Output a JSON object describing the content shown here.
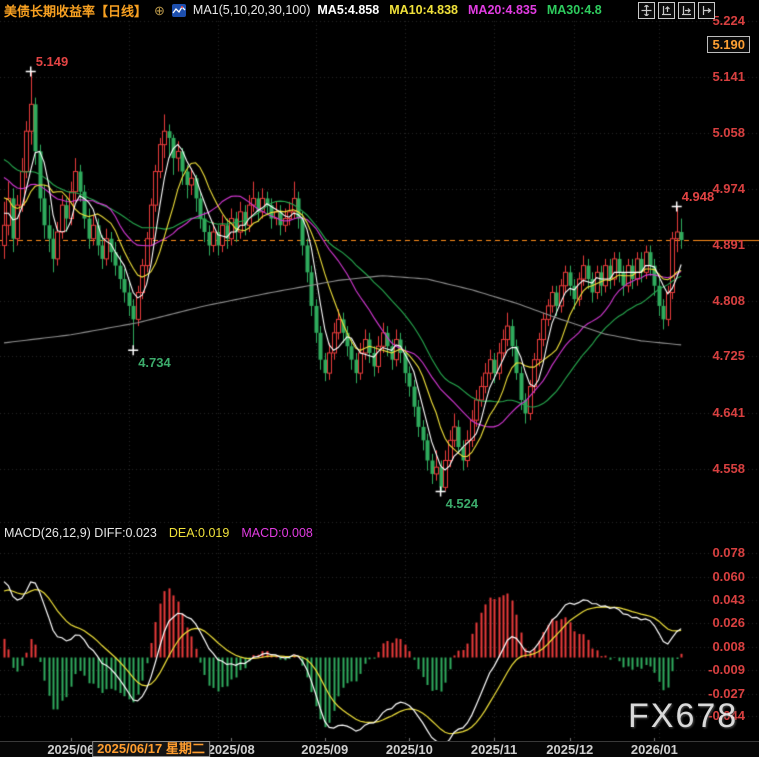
{
  "header": {
    "title": "美债长期收益率【日线】",
    "link_glyph": "⊕",
    "indicator_label": "MA1(5,10,20,30,100)",
    "ma_values": [
      {
        "label": "MA5:4.858",
        "color": "#ffffff"
      },
      {
        "label": "MA10:4.838",
        "color": "#f0e13a"
      },
      {
        "label": "MA20:4.835",
        "color": "#e23ce2"
      },
      {
        "label": "MA30:4.8",
        "color": "#2ecc5e"
      }
    ],
    "toolbar_icons": [
      "crosshair-move-icon",
      "y-axis-zoom-icon",
      "x-axis-zoom-icon",
      "pan-right-icon"
    ]
  },
  "colors": {
    "up": "#e83b3b",
    "down": "#2fab5d",
    "axis_text": "#d84040",
    "price_line": "#ff8c1a",
    "grid": "#262626",
    "ma5": "#ffffff",
    "ma10": "#f0e13a",
    "ma20": "#d438d4",
    "ma30": "#27a94f",
    "ma100": "#8f8f8f",
    "diff_line": "#ffffff",
    "dea_line": "#f0e13a",
    "highlight": "#ffa033"
  },
  "price_axis": {
    "ticks": [
      "5.224",
      "5.141",
      "5.058",
      "4.974",
      "4.891",
      "4.808",
      "4.725",
      "4.641",
      "4.558"
    ],
    "crosshair_value": "5.190"
  },
  "annotations": [
    {
      "text": "5.149",
      "value": 5.149,
      "candle_index": 6,
      "color": "#e34444",
      "placement": "above-right"
    },
    {
      "text": "4.734",
      "value": 4.734,
      "candle_index": 29,
      "color": "#3cab6b",
      "placement": "below-right"
    },
    {
      "text": "4.524",
      "value": 4.524,
      "candle_index": 98,
      "color": "#3cab6b",
      "placement": "below-right"
    },
    {
      "text": "4.948",
      "value": 4.948,
      "candle_index": 151,
      "color": "#e34444",
      "placement": "above-right"
    }
  ],
  "price_line": {
    "value": 4.898
  },
  "x_axis": {
    "ticks": [
      {
        "label": "2025/06",
        "idx": 15
      },
      {
        "label": "2025/08",
        "idx": 51
      },
      {
        "label": "2025/09",
        "idx": 72
      },
      {
        "label": "2025/10",
        "idx": 91
      },
      {
        "label": "2025/11",
        "idx": 110
      },
      {
        "label": "2025/12",
        "idx": 127
      },
      {
        "label": "2026/01",
        "idx": 146
      }
    ],
    "crosshair_label": "2025/06/17 星期二",
    "crosshair_idx": 33
  },
  "macd": {
    "legend_main": "MACD(26,12,9) DIFF:0.023",
    "legend_dea": "DEA:0.019",
    "legend_macd": "MACD:0.008",
    "ticks": [
      "0.078",
      "0.060",
      "0.043",
      "0.026",
      "0.008",
      "-0.009",
      "-0.027",
      "-0.044"
    ]
  },
  "watermark": "FX678",
  "chart_data": {
    "type": "candlestick",
    "title": "美债长期收益率 日线",
    "ylim": [
      4.46,
      5.26
    ],
    "price_ticks": [
      5.224,
      5.141,
      5.058,
      4.974,
      4.891,
      4.808,
      4.725,
      4.641,
      4.558
    ],
    "macd_ticks": [
      0.078,
      0.06,
      0.043,
      0.026,
      0.008,
      -0.009,
      -0.027,
      -0.044
    ],
    "macd_params": [
      26,
      12,
      9
    ],
    "macd_legend": {
      "diff": 0.023,
      "dea": 0.019,
      "macd": 0.008
    },
    "ma_legend": {
      "ma5": 4.858,
      "ma10": 4.838,
      "ma20": 4.835,
      "ma30": 4.8
    },
    "grid_vline_indices": [
      28,
      48,
      70,
      90,
      110,
      128,
      147
    ],
    "ma_prehistory": [
      5.08,
      5.09,
      5.1,
      5.09,
      5.08,
      5.07,
      5.08,
      5.06,
      5.05,
      5.06,
      5.04,
      5.05,
      5.03,
      5.04,
      5.02,
      5.03,
      5.01,
      5.02,
      5.0,
      5.01,
      5.0,
      4.99,
      5.0,
      4.98,
      4.97,
      4.98,
      4.96,
      4.95,
      4.94,
      4.92
    ],
    "ma100_anchors": [
      [
        0,
        4.745
      ],
      [
        15,
        4.757
      ],
      [
        30,
        4.775
      ],
      [
        45,
        4.8
      ],
      [
        60,
        4.82
      ],
      [
        75,
        4.838
      ],
      [
        85,
        4.845
      ],
      [
        95,
        4.84
      ],
      [
        105,
        4.824
      ],
      [
        115,
        4.804
      ],
      [
        125,
        4.78
      ],
      [
        135,
        4.758
      ],
      [
        143,
        4.748
      ],
      [
        152,
        4.742
      ]
    ],
    "candles": [
      [
        4.89,
        4.955,
        4.87,
        4.92
      ],
      [
        4.92,
        4.985,
        4.905,
        4.96
      ],
      [
        4.96,
        4.975,
        4.88,
        4.9
      ],
      [
        4.9,
        4.965,
        4.89,
        4.95
      ],
      [
        4.95,
        5.02,
        4.94,
        5.0
      ],
      [
        5.0,
        5.075,
        4.99,
        5.06
      ],
      [
        5.06,
        5.149,
        5.04,
        5.1
      ],
      [
        5.1,
        5.11,
        5.01,
        5.03
      ],
      [
        5.03,
        5.04,
        4.94,
        4.96
      ],
      [
        4.96,
        4.98,
        4.9,
        4.92
      ],
      [
        4.92,
        4.95,
        4.88,
        4.9
      ],
      [
        4.9,
        4.915,
        4.85,
        4.87
      ],
      [
        4.87,
        4.925,
        4.86,
        4.91
      ],
      [
        4.91,
        4.965,
        4.9,
        4.95
      ],
      [
        4.95,
        4.96,
        4.91,
        4.93
      ],
      [
        4.93,
        4.985,
        4.92,
        4.97
      ],
      [
        4.97,
        5.02,
        4.955,
        5.0
      ],
      [
        5.0,
        5.01,
        4.955,
        4.97
      ],
      [
        4.97,
        4.98,
        4.915,
        4.93
      ],
      [
        4.93,
        4.945,
        4.885,
        4.9
      ],
      [
        4.9,
        4.935,
        4.89,
        4.92
      ],
      [
        4.92,
        4.93,
        4.875,
        4.89
      ],
      [
        4.89,
        4.905,
        4.855,
        4.87
      ],
      [
        4.87,
        4.915,
        4.86,
        4.9
      ],
      [
        4.9,
        4.91,
        4.865,
        4.88
      ],
      [
        4.88,
        4.895,
        4.845,
        4.86
      ],
      [
        4.86,
        4.875,
        4.825,
        4.84
      ],
      [
        4.84,
        4.855,
        4.805,
        4.82
      ],
      [
        4.82,
        4.835,
        4.785,
        4.8
      ],
      [
        4.8,
        4.81,
        4.734,
        4.78
      ],
      [
        4.78,
        4.83,
        4.77,
        4.82
      ],
      [
        4.82,
        4.87,
        4.81,
        4.86
      ],
      [
        4.86,
        4.91,
        4.85,
        4.9
      ],
      [
        4.9,
        4.96,
        4.89,
        4.95
      ],
      [
        4.95,
        5.01,
        4.94,
        5.0
      ],
      [
        5.0,
        5.05,
        4.99,
        5.04
      ],
      [
        5.04,
        5.085,
        5.02,
        5.06
      ],
      [
        5.06,
        5.07,
        5.02,
        5.05
      ],
      [
        5.05,
        5.055,
        4.995,
        5.02
      ],
      [
        5.02,
        5.045,
        5.0,
        5.03
      ],
      [
        5.03,
        5.035,
        4.98,
        5.0
      ],
      [
        5.0,
        5.01,
        4.96,
        4.98
      ],
      [
        4.98,
        5.005,
        4.965,
        4.99
      ],
      [
        4.99,
        4.995,
        4.94,
        4.96
      ],
      [
        4.96,
        4.97,
        4.915,
        4.93
      ],
      [
        4.93,
        4.94,
        4.895,
        4.91
      ],
      [
        4.91,
        4.92,
        4.875,
        4.89
      ],
      [
        4.89,
        4.925,
        4.88,
        4.91
      ],
      [
        4.91,
        4.92,
        4.875,
        4.89
      ],
      [
        4.89,
        4.935,
        4.88,
        4.92
      ],
      [
        4.92,
        4.93,
        4.885,
        4.9
      ],
      [
        4.9,
        4.945,
        4.89,
        4.93
      ],
      [
        4.93,
        4.94,
        4.895,
        4.91
      ],
      [
        4.91,
        4.955,
        4.9,
        4.94
      ],
      [
        4.94,
        4.95,
        4.905,
        4.92
      ],
      [
        4.92,
        4.965,
        4.91,
        4.95
      ],
      [
        4.95,
        4.985,
        4.94,
        4.96
      ],
      [
        4.96,
        4.97,
        4.925,
        4.94
      ],
      [
        4.94,
        4.975,
        4.93,
        4.96
      ],
      [
        4.96,
        4.97,
        4.935,
        4.95
      ],
      [
        4.95,
        4.96,
        4.915,
        4.93
      ],
      [
        4.93,
        4.955,
        4.92,
        4.94
      ],
      [
        4.94,
        4.95,
        4.905,
        4.92
      ],
      [
        4.92,
        4.945,
        4.91,
        4.93
      ],
      [
        4.93,
        4.955,
        4.92,
        4.94
      ],
      [
        4.94,
        4.985,
        4.93,
        4.96
      ],
      [
        4.96,
        4.97,
        4.915,
        4.93
      ],
      [
        4.93,
        4.94,
        4.875,
        4.89
      ],
      [
        4.89,
        4.9,
        4.835,
        4.85
      ],
      [
        4.85,
        4.86,
        4.785,
        4.8
      ],
      [
        4.8,
        4.81,
        4.745,
        4.76
      ],
      [
        4.76,
        4.77,
        4.705,
        4.72
      ],
      [
        4.72,
        4.73,
        4.688,
        4.7
      ],
      [
        4.7,
        4.745,
        4.69,
        4.73
      ],
      [
        4.73,
        4.775,
        4.72,
        4.76
      ],
      [
        4.76,
        4.795,
        4.75,
        4.78
      ],
      [
        4.78,
        4.79,
        4.745,
        4.76
      ],
      [
        4.76,
        4.77,
        4.725,
        4.74
      ],
      [
        4.74,
        4.75,
        4.705,
        4.72
      ],
      [
        4.72,
        4.73,
        4.685,
        4.7
      ],
      [
        4.7,
        4.745,
        4.69,
        4.73
      ],
      [
        4.73,
        4.765,
        4.72,
        4.75
      ],
      [
        4.75,
        4.76,
        4.715,
        4.73
      ],
      [
        4.73,
        4.74,
        4.695,
        4.71
      ],
      [
        4.71,
        4.755,
        4.7,
        4.74
      ],
      [
        4.74,
        4.775,
        4.73,
        4.76
      ],
      [
        4.76,
        4.77,
        4.725,
        4.74
      ],
      [
        4.74,
        4.75,
        4.705,
        4.72
      ],
      [
        4.72,
        4.765,
        4.71,
        4.75
      ],
      [
        4.75,
        4.76,
        4.715,
        4.73
      ],
      [
        4.73,
        4.74,
        4.685,
        4.7
      ],
      [
        4.7,
        4.71,
        4.665,
        4.68
      ],
      [
        4.68,
        4.69,
        4.635,
        4.65
      ],
      [
        4.65,
        4.66,
        4.605,
        4.62
      ],
      [
        4.62,
        4.63,
        4.585,
        4.6
      ],
      [
        4.6,
        4.61,
        4.555,
        4.57
      ],
      [
        4.57,
        4.58,
        4.535,
        4.55
      ],
      [
        4.55,
        4.585,
        4.54,
        4.56
      ],
      [
        4.56,
        4.57,
        4.524,
        4.53
      ],
      [
        4.53,
        4.585,
        4.525,
        4.57
      ],
      [
        4.57,
        4.615,
        4.56,
        4.6
      ],
      [
        4.6,
        4.64,
        4.59,
        4.62
      ],
      [
        4.62,
        4.63,
        4.58,
        4.59
      ],
      [
        4.59,
        4.6,
        4.555,
        4.57
      ],
      [
        4.57,
        4.615,
        4.56,
        4.6
      ],
      [
        4.6,
        4.645,
        4.59,
        4.63
      ],
      [
        4.63,
        4.675,
        4.62,
        4.66
      ],
      [
        4.66,
        4.695,
        4.65,
        4.68
      ],
      [
        4.68,
        4.715,
        4.67,
        4.7
      ],
      [
        4.7,
        4.735,
        4.69,
        4.72
      ],
      [
        4.72,
        4.73,
        4.685,
        4.7
      ],
      [
        4.7,
        4.745,
        4.69,
        4.73
      ],
      [
        4.73,
        4.765,
        4.72,
        4.75
      ],
      [
        4.75,
        4.79,
        4.74,
        4.77
      ],
      [
        4.77,
        4.78,
        4.725,
        4.74
      ],
      [
        4.74,
        4.75,
        4.69,
        4.7
      ],
      [
        4.7,
        4.71,
        4.645,
        4.66
      ],
      [
        4.66,
        4.67,
        4.625,
        4.64
      ],
      [
        4.64,
        4.69,
        4.63,
        4.68
      ],
      [
        4.68,
        4.73,
        4.67,
        4.72
      ],
      [
        4.72,
        4.76,
        4.71,
        4.75
      ],
      [
        4.75,
        4.79,
        4.74,
        4.78
      ],
      [
        4.78,
        4.81,
        4.77,
        4.8
      ],
      [
        4.8,
        4.83,
        4.79,
        4.82
      ],
      [
        4.82,
        4.83,
        4.785,
        4.8
      ],
      [
        4.8,
        4.84,
        4.79,
        4.83
      ],
      [
        4.83,
        4.86,
        4.82,
        4.85
      ],
      [
        4.85,
        4.86,
        4.815,
        4.83
      ],
      [
        4.83,
        4.84,
        4.795,
        4.81
      ],
      [
        4.81,
        4.85,
        4.8,
        4.84
      ],
      [
        4.84,
        4.875,
        4.83,
        4.86
      ],
      [
        4.86,
        4.87,
        4.825,
        4.84
      ],
      [
        4.84,
        4.85,
        4.805,
        4.82
      ],
      [
        4.82,
        4.86,
        4.81,
        4.85
      ],
      [
        4.85,
        4.86,
        4.815,
        4.83
      ],
      [
        4.83,
        4.87,
        4.82,
        4.86
      ],
      [
        4.86,
        4.87,
        4.825,
        4.84
      ],
      [
        4.84,
        4.88,
        4.83,
        4.87
      ],
      [
        4.87,
        4.88,
        4.835,
        4.85
      ],
      [
        4.85,
        4.86,
        4.815,
        4.83
      ],
      [
        4.83,
        4.87,
        4.82,
        4.86
      ],
      [
        4.86,
        4.87,
        4.825,
        4.84
      ],
      [
        4.84,
        4.88,
        4.83,
        4.87
      ],
      [
        4.87,
        4.88,
        4.835,
        4.85
      ],
      [
        4.85,
        4.89,
        4.84,
        4.88
      ],
      [
        4.88,
        4.89,
        4.845,
        4.86
      ],
      [
        4.86,
        4.87,
        4.815,
        4.83
      ],
      [
        4.83,
        4.84,
        4.785,
        4.8
      ],
      [
        4.8,
        4.81,
        4.765,
        4.78
      ],
      [
        4.78,
        4.83,
        4.77,
        4.82
      ],
      [
        4.82,
        4.91,
        4.81,
        4.9
      ],
      [
        4.9,
        4.948,
        4.88,
        4.91
      ],
      [
        4.91,
        4.93,
        4.885,
        4.898
      ]
    ]
  }
}
